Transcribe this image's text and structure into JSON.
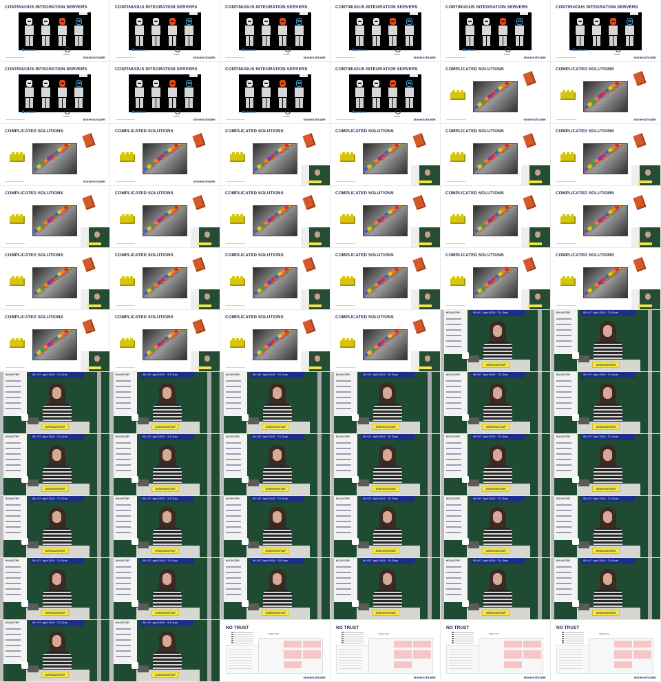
{
  "sheet": {
    "columns": 6,
    "company_logo": "sinnerschrader",
    "tiles": [
      {
        "kind": "ci",
        "title": "CONTINUOUS INTEGRATION SERVERS"
      },
      {
        "kind": "ci",
        "title": "CONTINUOUS INTEGRATION SERVERS"
      },
      {
        "kind": "ci",
        "title": "CONTINUOUS INTEGRATION SERVERS"
      },
      {
        "kind": "ci",
        "title": "CONTINUOUS INTEGRATION SERVERS"
      },
      {
        "kind": "ci",
        "title": "CONTINUOUS INTEGRATION SERVERS"
      },
      {
        "kind": "ci",
        "title": "CONTINUOUS INTEGRATION SERVERS"
      },
      {
        "kind": "ci",
        "title": "CONTINUOUS INTEGRATION SERVERS"
      },
      {
        "kind": "ci",
        "title": "CONTINUOUS INTEGRATION SERVERS"
      },
      {
        "kind": "ci",
        "title": "CONTINUOUS INTEGRATION SERVERS"
      },
      {
        "kind": "ci",
        "title": "CONTINUOUS INTEGRATION SERVERS"
      },
      {
        "kind": "cs",
        "title": "COMPLICATED SOLUTIONS",
        "inset": false
      },
      {
        "kind": "cs",
        "title": "COMPLICATED SOLUTIONS",
        "inset": false
      },
      {
        "kind": "cs",
        "title": "COMPLICATED SOLUTIONS",
        "inset": false
      },
      {
        "kind": "cs",
        "title": "COMPLICATED SOLUTIONS",
        "inset": false
      },
      {
        "kind": "cs",
        "title": "COMPLICATED SOLUTIONS",
        "inset": true
      },
      {
        "kind": "cs",
        "title": "COMPLICATED SOLUTIONS",
        "inset": true
      },
      {
        "kind": "cs",
        "title": "COMPLICATED SOLUTIONS",
        "inset": true
      },
      {
        "kind": "cs",
        "title": "COMPLICATED SOLUTIONS",
        "inset": true
      },
      {
        "kind": "cs",
        "title": "COMPLICATED SOLUTIONS",
        "inset": true
      },
      {
        "kind": "cs",
        "title": "COMPLICATED SOLUTIONS",
        "inset": true
      },
      {
        "kind": "cs",
        "title": "COMPLICATED SOLUTIONS",
        "inset": true
      },
      {
        "kind": "cs",
        "title": "COMPLICATED SOLUTIONS",
        "inset": true
      },
      {
        "kind": "cs",
        "title": "COMPLICATED SOLUTIONS",
        "inset": true
      },
      {
        "kind": "cs",
        "title": "COMPLICATED SOLUTIONS",
        "inset": true
      },
      {
        "kind": "cs",
        "title": "COMPLICATED SOLUTIONS",
        "inset": true
      },
      {
        "kind": "cs",
        "title": "COMPLICATED SOLUTIONS",
        "inset": true
      },
      {
        "kind": "cs",
        "title": "COMPLICATED SOLUTIONS",
        "inset": true
      },
      {
        "kind": "cs",
        "title": "COMPLICATED SOLUTIONS",
        "inset": true
      },
      {
        "kind": "cs",
        "title": "COMPLICATED SOLUTIONS",
        "inset": true
      },
      {
        "kind": "cs",
        "title": "COMPLICATED SOLUTIONS",
        "inset": true
      },
      {
        "kind": "cs",
        "title": "COMPLICATED SOLUTIONS",
        "inset": true
      },
      {
        "kind": "cs",
        "title": "COMPLICATED SOLUTIONS",
        "inset": true
      },
      {
        "kind": "cs",
        "title": "COMPLICATED SOLUTIONS",
        "inset": true
      },
      {
        "kind": "cs",
        "title": "COMPLICATED SOLUTIONS",
        "inset": true
      },
      {
        "kind": "speaker"
      },
      {
        "kind": "speaker"
      },
      {
        "kind": "speaker"
      },
      {
        "kind": "speaker"
      },
      {
        "kind": "speaker"
      },
      {
        "kind": "speaker"
      },
      {
        "kind": "speaker"
      },
      {
        "kind": "speaker"
      },
      {
        "kind": "speaker"
      },
      {
        "kind": "speaker"
      },
      {
        "kind": "speaker"
      },
      {
        "kind": "speaker"
      },
      {
        "kind": "speaker"
      },
      {
        "kind": "speaker"
      },
      {
        "kind": "speaker"
      },
      {
        "kind": "speaker"
      },
      {
        "kind": "speaker"
      },
      {
        "kind": "speaker"
      },
      {
        "kind": "speaker"
      },
      {
        "kind": "speaker"
      },
      {
        "kind": "speaker"
      },
      {
        "kind": "speaker"
      },
      {
        "kind": "speaker"
      },
      {
        "kind": "speaker"
      },
      {
        "kind": "speaker"
      },
      {
        "kind": "speaker"
      },
      {
        "kind": "speaker"
      },
      {
        "kind": "speaker"
      },
      {
        "kind": "notrust",
        "title": "NO TRUST",
        "stage_label": "Stage View"
      },
      {
        "kind": "notrust",
        "title": "NO TRUST",
        "stage_label": "Stage View"
      },
      {
        "kind": "notrust",
        "title": "NO TRUST",
        "stage_label": "Stage View"
      },
      {
        "kind": "notrust",
        "title": "NO TRUST",
        "stage_label": "Stage View"
      }
    ],
    "ci_labels": {
      "bamboo": "Bamboo",
      "tc": "TC",
      "circle": "CircleCI"
    },
    "speaker_texts": {
      "banner_title": "BOOKSTER",
      "date": "06.+07. April 2019 · TU Graz",
      "sign": "Seitenwechsel"
    },
    "colors": {
      "title_navy": "#1b2a55",
      "chalkboard_green": "#1f4b33",
      "sign_yellow": "#f4e94c",
      "brick_red": "#d5582a",
      "brick_yellow": "#d7c40f",
      "alert_pink": "#f7c5c5"
    }
  }
}
